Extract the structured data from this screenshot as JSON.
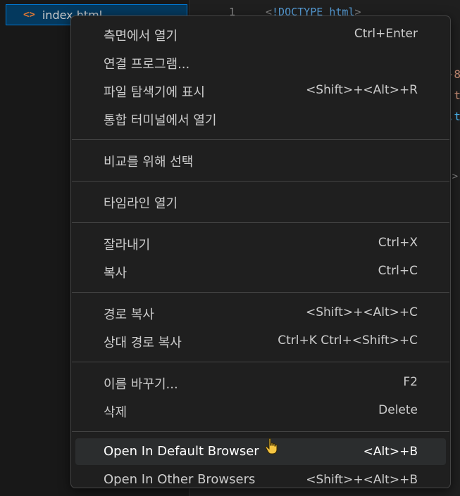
{
  "explorer": {
    "file_icon": "<>",
    "file_name": "index.html"
  },
  "editor": {
    "line_number": "1",
    "code_punct_open": "<",
    "code_doctype": "!DOCTYPE",
    "code_html": "html",
    "code_punct_close": ">",
    "peek_1": "-8",
    "peek_2": "t",
    "peek_3": ".t",
    "peek_chevron": ">"
  },
  "context_menu": {
    "groups": [
      [
        {
          "label": "측면에서 열기",
          "shortcut": "Ctrl+Enter"
        },
        {
          "label": "연결 프로그램...",
          "shortcut": ""
        },
        {
          "label": "파일 탐색기에 표시",
          "shortcut": "<Shift>+<Alt>+R"
        },
        {
          "label": "통합 터미널에서 열기",
          "shortcut": ""
        }
      ],
      [
        {
          "label": "비교를 위해 선택",
          "shortcut": ""
        }
      ],
      [
        {
          "label": "타임라인 열기",
          "shortcut": ""
        }
      ],
      [
        {
          "label": "잘라내기",
          "shortcut": "Ctrl+X"
        },
        {
          "label": "복사",
          "shortcut": "Ctrl+C"
        }
      ],
      [
        {
          "label": "경로 복사",
          "shortcut": "<Shift>+<Alt>+C"
        },
        {
          "label": "상대 경로 복사",
          "shortcut": "Ctrl+K Ctrl+<Shift>+C"
        }
      ],
      [
        {
          "label": "이름 바꾸기...",
          "shortcut": "F2"
        },
        {
          "label": "삭제",
          "shortcut": "Delete"
        }
      ],
      [
        {
          "label": "Open In Default Browser",
          "shortcut": "<Alt>+B",
          "hovered": true
        },
        {
          "label": "Open In Other Browsers",
          "shortcut": "<Shift>+<Alt>+B"
        }
      ]
    ]
  },
  "colors": {
    "accent": "#0078d4",
    "menu_bg": "#1f1f1f",
    "menu_hover": "#2b2d2e",
    "text": "#cccccc"
  }
}
